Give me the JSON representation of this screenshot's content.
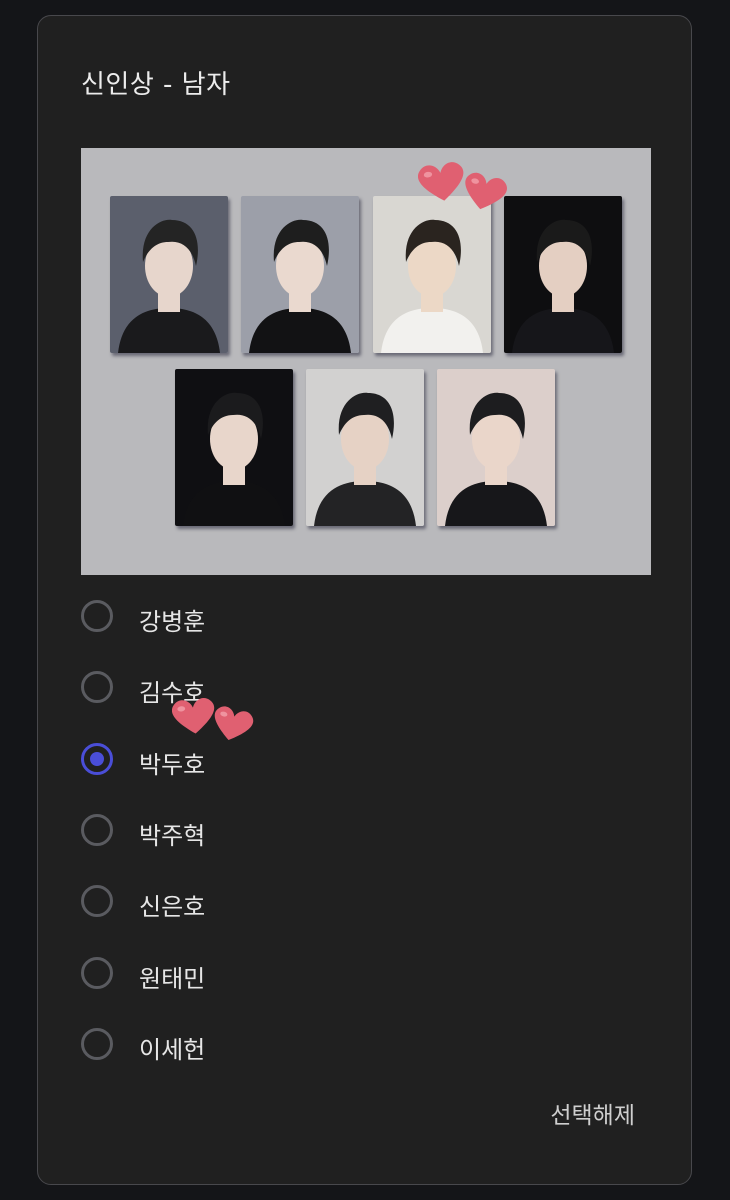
{
  "card": {
    "title": "신인상 - 남자",
    "clear_label": "선택해제"
  },
  "photos": [
    {
      "name": "photo-1",
      "bg": "#5b5f6c",
      "shirt": "#1a1a1c",
      "skin": "#e7d6cc",
      "hair": "#242424"
    },
    {
      "name": "photo-2",
      "bg": "#9c9fa9",
      "shirt": "#121214",
      "skin": "#ead9cf",
      "hair": "#1e1e1e"
    },
    {
      "name": "photo-3",
      "bg": "#d9d7d2",
      "shirt": "#f2f1ee",
      "skin": "#ecd8c6",
      "hair": "#2a241f"
    },
    {
      "name": "photo-4",
      "bg": "#0e0e10",
      "shirt": "#16161a",
      "skin": "#e4cfc2",
      "hair": "#1a1a1a"
    },
    {
      "name": "photo-5",
      "bg": "#0f0f12",
      "shirt": "#101012",
      "skin": "#e8d6cb",
      "hair": "#1b1b1d"
    },
    {
      "name": "photo-6",
      "bg": "#d2d1d0",
      "shirt": "#232325",
      "skin": "#e6d2c5",
      "hair": "#1f1f21"
    },
    {
      "name": "photo-7",
      "bg": "#dccfcb",
      "shirt": "#17171a",
      "skin": "#ead6ca",
      "hair": "#1d1d1f"
    }
  ],
  "options": [
    {
      "label": "강병훈",
      "checked": false
    },
    {
      "label": "김수호",
      "checked": false
    },
    {
      "label": "박두호",
      "checked": true
    },
    {
      "label": "박주혁",
      "checked": false
    },
    {
      "label": "신은호",
      "checked": false
    },
    {
      "label": "원태민",
      "checked": false
    },
    {
      "label": "이세헌",
      "checked": false
    }
  ],
  "colors": {
    "accent": "#4a4ed8",
    "heart": "#e06071",
    "card_bg": "#202020",
    "page_bg": "#141518"
  }
}
